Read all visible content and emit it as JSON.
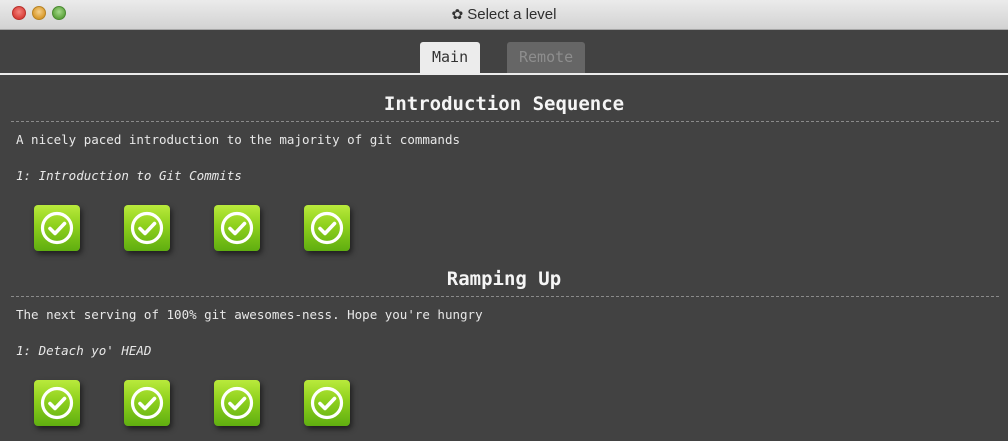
{
  "window": {
    "title": "Select a level",
    "title_icon": "gear-icon",
    "title_icon_glyph": "✿"
  },
  "tabs": [
    {
      "label": "Main",
      "active": true
    },
    {
      "label": "Remote",
      "active": false
    }
  ],
  "sections": [
    {
      "title": "Introduction Sequence",
      "description": "A nicely paced introduction to the majority of git commands",
      "level_name": "1: Introduction to Git Commits",
      "levels": [
        {
          "icon": "check-circle-icon",
          "completed": true
        },
        {
          "icon": "check-circle-icon",
          "completed": true
        },
        {
          "icon": "check-circle-icon",
          "completed": true
        },
        {
          "icon": "check-circle-icon",
          "completed": true
        }
      ]
    },
    {
      "title": "Ramping Up",
      "description": "The next serving of 100% git awesomes-ness. Hope you're hungry",
      "level_name": "1: Detach yo' HEAD",
      "levels": [
        {
          "icon": "check-circle-icon",
          "completed": true
        },
        {
          "icon": "check-circle-icon",
          "completed": true
        },
        {
          "icon": "check-circle-icon",
          "completed": true
        },
        {
          "icon": "check-circle-icon",
          "completed": true
        }
      ]
    }
  ],
  "colors": {
    "background": "#424242",
    "level_icon_green": "#8ed01d",
    "tab_active": "#ececec",
    "tab_inactive": "#666666"
  }
}
